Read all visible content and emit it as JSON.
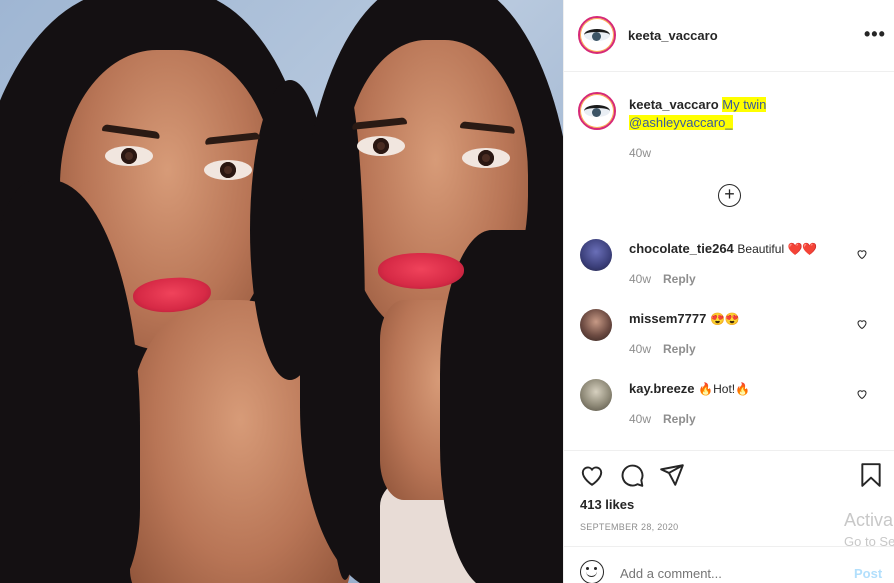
{
  "post": {
    "username": "keeta_vaccaro",
    "more_label": "•••",
    "caption_user": "keeta_vaccaro",
    "caption_text": "My twin",
    "caption_mention": "@ashleyvaccaro_",
    "caption_time": "40w",
    "load_more": "+"
  },
  "comments": [
    {
      "user": "chocolate_tie264",
      "text": "Beautiful ❤️❤️",
      "time": "40w",
      "reply": "Reply"
    },
    {
      "user": "missem7777",
      "text": "😍😍",
      "time": "40w",
      "reply": "Reply"
    },
    {
      "user": "kay.breeze",
      "text": "🔥Hot!🔥",
      "time": "40w",
      "reply": "Reply"
    }
  ],
  "footer": {
    "likes": "413 likes",
    "date": "SEPTEMBER 28, 2020",
    "comment_placeholder": "Add a comment...",
    "post_label": "Post"
  },
  "watermark": {
    "line1": "Activa",
    "line2": "Go to Se"
  },
  "colors": {
    "highlight": "#ffff00",
    "mention": "#3a5a9c",
    "muted": "#8e8e8e",
    "post_disabled": "#b2dffc"
  },
  "icons": [
    "more-options-icon",
    "add-circle-icon",
    "heart-icon",
    "comment-icon",
    "share-icon",
    "bookmark-icon",
    "emoji-icon"
  ]
}
